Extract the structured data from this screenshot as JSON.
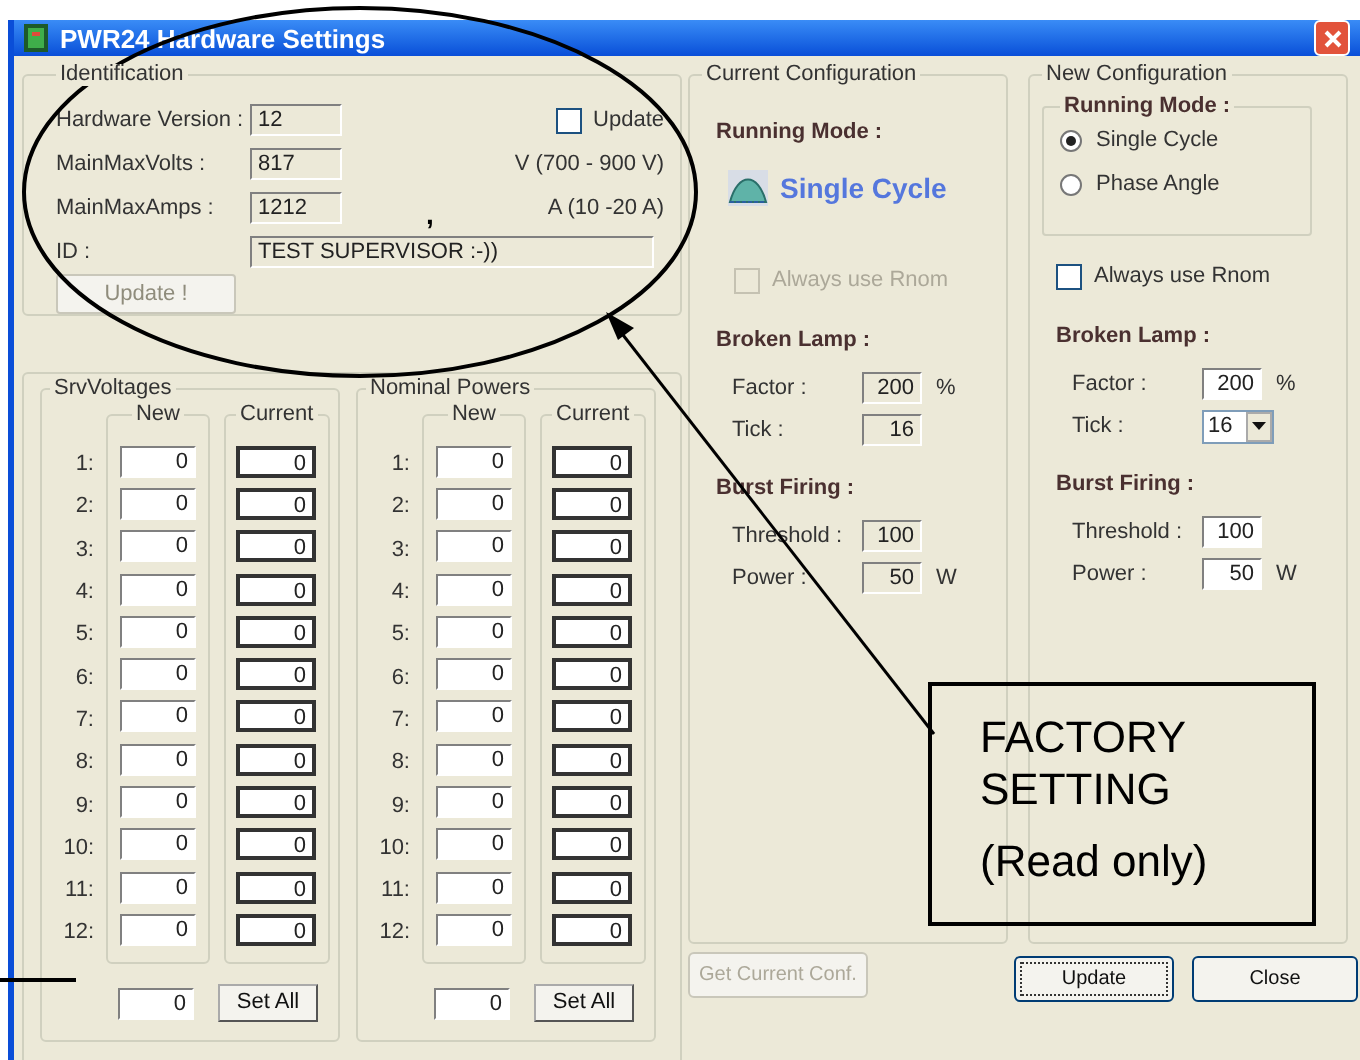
{
  "window": {
    "title": "PWR24 Hardware Settings"
  },
  "identification": {
    "title": "Identification",
    "fields": [
      {
        "label": "Hardware Version :",
        "value": "12"
      },
      {
        "label": "MainMaxVolts :",
        "value": "817",
        "hint": "V (700 - 900 V)"
      },
      {
        "label": "MainMaxAmps :",
        "value": "1212",
        "hint": "A (10 -20 A)"
      }
    ],
    "update_checkbox": {
      "label": "Update",
      "checked": false
    },
    "id": {
      "label": "ID :",
      "value": "TEST SUPERVISOR :-))"
    },
    "update_button": {
      "label": "Update !",
      "disabled": true
    }
  },
  "grids": [
    {
      "title": "SrvVoltages",
      "columns": [
        "New",
        "Current"
      ],
      "rows": [
        {
          "label": "1:",
          "new": "0",
          "current": "0"
        },
        {
          "label": "2:",
          "new": "0",
          "current": "0"
        },
        {
          "label": "3:",
          "new": "0",
          "current": "0"
        },
        {
          "label": "4:",
          "new": "0",
          "current": "0"
        },
        {
          "label": "5:",
          "new": "0",
          "current": "0"
        },
        {
          "label": "6:",
          "new": "0",
          "current": "0"
        },
        {
          "label": "7:",
          "new": "0",
          "current": "0"
        },
        {
          "label": "8:",
          "new": "0",
          "current": "0"
        },
        {
          "label": "9:",
          "new": "0",
          "current": "0"
        },
        {
          "label": "10:",
          "new": "0",
          "current": "0"
        },
        {
          "label": "11:",
          "new": "0",
          "current": "0"
        },
        {
          "label": "12:",
          "new": "0",
          "current": "0"
        }
      ],
      "all_value": "0",
      "set_all": "Set All"
    },
    {
      "title": "Nominal Powers",
      "columns": [
        "New",
        "Current"
      ],
      "rows": [
        {
          "label": "1:",
          "new": "0",
          "current": "0"
        },
        {
          "label": "2:",
          "new": "0",
          "current": "0"
        },
        {
          "label": "3:",
          "new": "0",
          "current": "0"
        },
        {
          "label": "4:",
          "new": "0",
          "current": "0"
        },
        {
          "label": "5:",
          "new": "0",
          "current": "0"
        },
        {
          "label": "6:",
          "new": "0",
          "current": "0"
        },
        {
          "label": "7:",
          "new": "0",
          "current": "0"
        },
        {
          "label": "8:",
          "new": "0",
          "current": "0"
        },
        {
          "label": "9:",
          "new": "0",
          "current": "0"
        },
        {
          "label": "10:",
          "new": "0",
          "current": "0"
        },
        {
          "label": "11:",
          "new": "0",
          "current": "0"
        },
        {
          "label": "12:",
          "new": "0",
          "current": "0"
        }
      ],
      "all_value": "0",
      "set_all": "Set All"
    }
  ],
  "current_config": {
    "title": "Current Configuration",
    "running_mode_label": "Running Mode :",
    "running_mode": "Single Cycle",
    "always_use_rnom": {
      "label": "Always use Rnom",
      "checked": false,
      "disabled": true
    },
    "broken_lamp": {
      "title": "Broken Lamp :",
      "factor_label": "Factor :",
      "factor": "200",
      "factor_unit": "%",
      "tick_label": "Tick :",
      "tick": "16"
    },
    "burst_firing": {
      "title": "Burst Firing :",
      "threshold_label": "Threshold :",
      "threshold": "100",
      "power_label": "Power :",
      "power": "50",
      "power_unit": "W"
    }
  },
  "new_config": {
    "title": "New Configuration",
    "running_mode_label": "Running Mode :",
    "modes": [
      {
        "label": "Single Cycle",
        "selected": true
      },
      {
        "label": "Phase Angle",
        "selected": false
      }
    ],
    "always_use_rnom": {
      "label": "Always use Rnom",
      "checked": false,
      "disabled": false
    },
    "broken_lamp": {
      "title": "Broken Lamp :",
      "factor_label": "Factor :",
      "factor": "200",
      "factor_unit": "%",
      "tick_label": "Tick :",
      "tick": "16"
    },
    "burst_firing": {
      "title": "Burst Firing :",
      "threshold_label": "Threshold :",
      "threshold": "100",
      "power_label": "Power :",
      "power": "50",
      "power_unit": "W"
    }
  },
  "buttons": [
    {
      "label": "Get Current Conf.",
      "disabled": true,
      "focused": false
    },
    {
      "label": "Update",
      "disabled": false,
      "focused": true
    },
    {
      "label": "Close",
      "disabled": false,
      "focused": false
    }
  ],
  "annotation": {
    "stray_mark": ",",
    "callout": [
      "FACTORY",
      "SETTING",
      "(Read only)"
    ]
  }
}
